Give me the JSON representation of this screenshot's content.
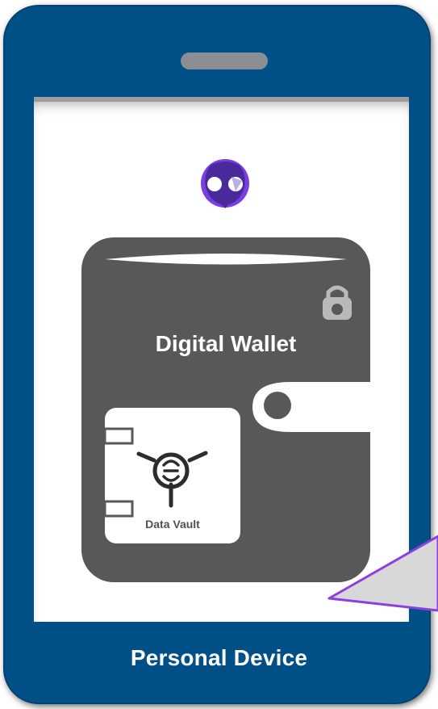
{
  "device": {
    "label": "Personal Device",
    "frame_color": "#004f86"
  },
  "wallet": {
    "title": "Digital Wallet",
    "color": "#585858"
  },
  "vault": {
    "label": "Data Vault"
  },
  "icons": {
    "app_logo": "owl-logo-icon",
    "lock": "padlock-icon",
    "vault_handle": "vault-wheel-icon"
  },
  "accent_color": "#8e3fe0"
}
